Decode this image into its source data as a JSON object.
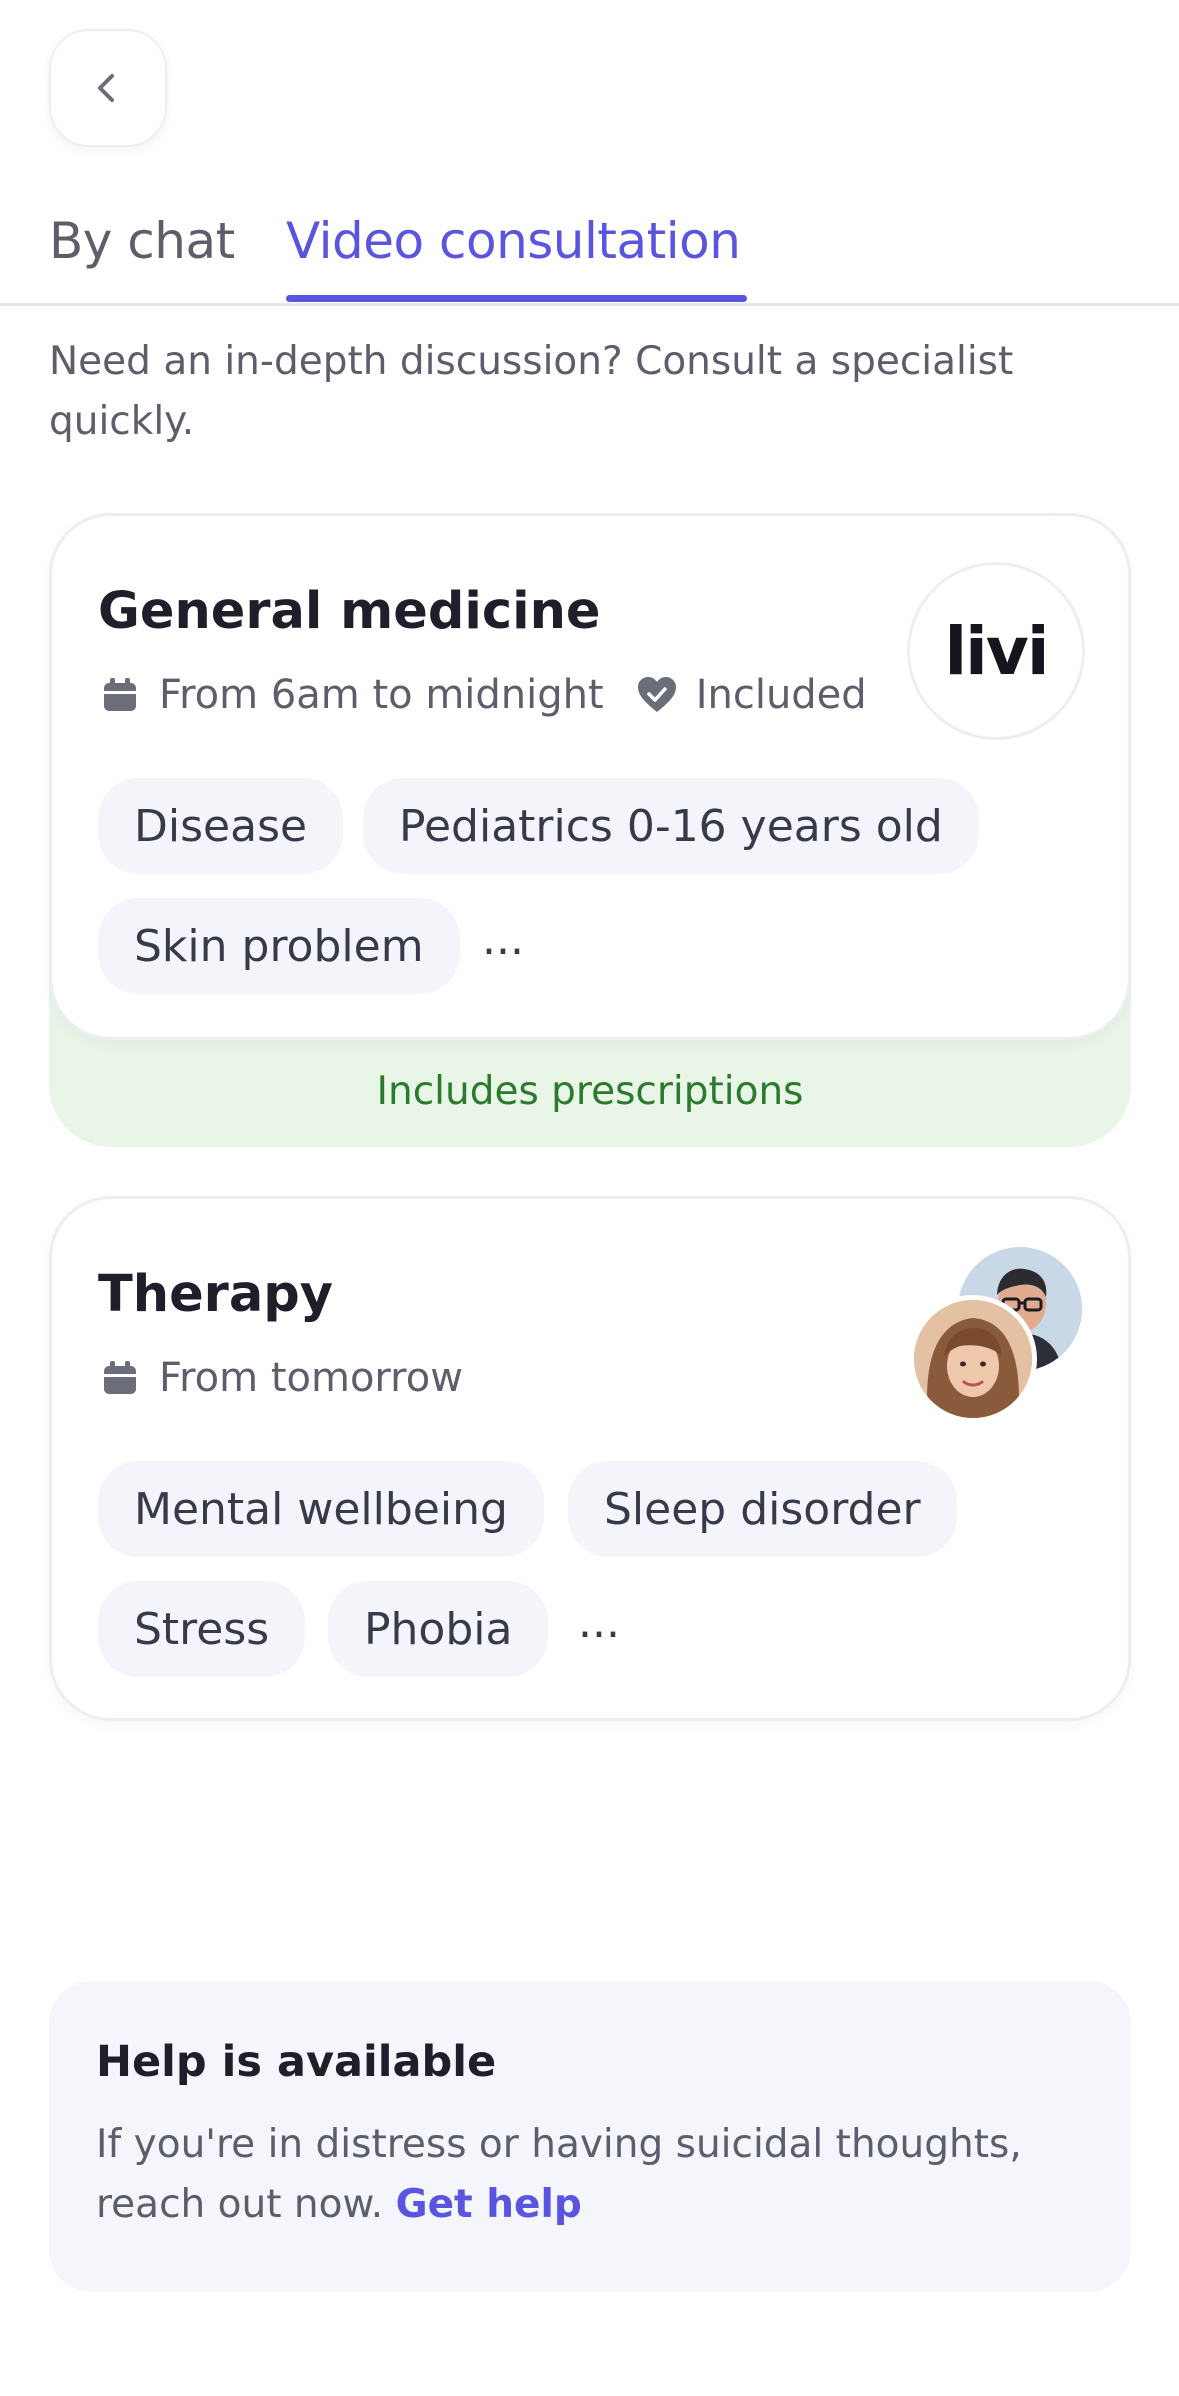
{
  "tabs": [
    {
      "label": "By chat",
      "active": false
    },
    {
      "label": "Video consultation",
      "active": true
    }
  ],
  "intro": "Need an in-depth discussion? Consult a specialist quickly.",
  "general": {
    "title": "General medicine",
    "schedule": "From 6am to midnight",
    "coverage": "Included",
    "logo": "livi",
    "chips": [
      "Disease",
      "Pediatrics 0-16 years old",
      "Skin problem"
    ],
    "more": "...",
    "footer": "Includes prescriptions"
  },
  "therapy": {
    "title": "Therapy",
    "schedule": "From tomorrow",
    "chips": [
      "Mental wellbeing",
      "Sleep disorder",
      "Stress",
      "Phobia"
    ],
    "more": "..."
  },
  "help": {
    "title": "Help is available",
    "text": "If you're in distress or having suicidal thoughts, reach out now.",
    "link": "Get help"
  },
  "icons": {
    "back": "chevron-left-icon",
    "schedule": "calendar-icon",
    "coverage": "heart-check-icon"
  },
  "colors": {
    "accent": "#5a55e0",
    "prescription_bg": "#e8f5e7",
    "prescription_text": "#2b7a2e",
    "chip_bg": "#f3f5fb"
  }
}
